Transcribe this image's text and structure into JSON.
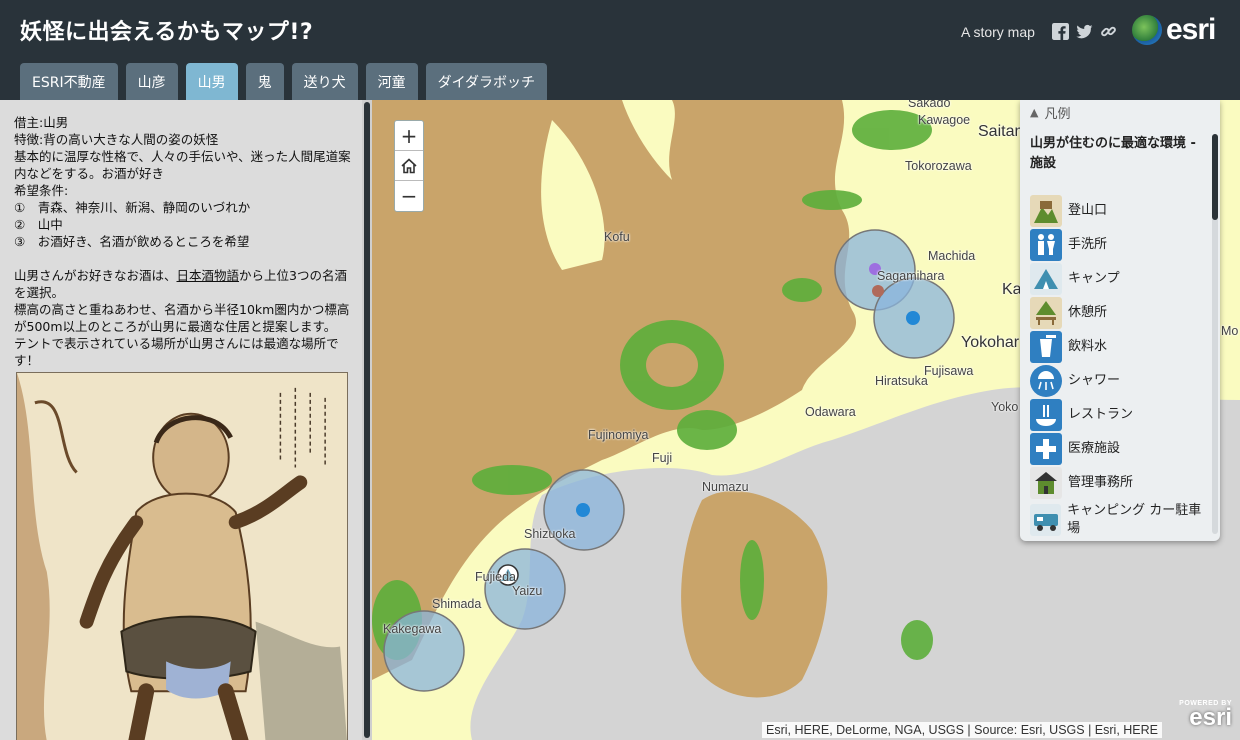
{
  "app": {
    "title": "妖怪に出会えるかもマップ!?",
    "story_link": "A story map",
    "share_icons": [
      "facebook-icon",
      "twitter-icon",
      "link-icon"
    ],
    "logo_text": "esri"
  },
  "tabs": [
    {
      "label": "ESRI不動産",
      "active": false
    },
    {
      "label": "山彦",
      "active": false
    },
    {
      "label": "山男",
      "active": true
    },
    {
      "label": "鬼",
      "active": false
    },
    {
      "label": "送り犬",
      "active": false
    },
    {
      "label": "河童",
      "active": false
    },
    {
      "label": "ダイダラボッチ",
      "active": false
    }
  ],
  "panel": {
    "lines": [
      "借主:山男",
      "特徴:背の高い大きな人間の姿の妖怪",
      "基本的に温厚な性格で、人々の手伝いや、迷った人間尾道案内などをする。お酒が好き",
      "希望条件:",
      "①　青森、神奈川、新潟、静岡のいづれか",
      "②　山中",
      "③　お酒好き、名酒が飲めるところを希望"
    ],
    "para2_before": "山男さんがお好きなお酒は、",
    "para2_link": "日本酒物語",
    "para2_after": "から上位3つの名酒を選択。",
    "para3": "標高の高さと重ねあわせ、名酒から半径10km圏内かつ標高が500m以上のところが山男に最適な住居と提案します。",
    "para4": "テントで表示されている場所が山男さんには最適な場所です！"
  },
  "map": {
    "places": [
      {
        "name": "Sakado",
        "big": false
      },
      {
        "name": "Kawagoe",
        "big": false
      },
      {
        "name": "Saitam",
        "big": true
      },
      {
        "name": "Tokorozawa",
        "big": false
      },
      {
        "name": "Kofu",
        "big": false
      },
      {
        "name": "Machida",
        "big": false
      },
      {
        "name": "Sagamihara",
        "big": false
      },
      {
        "name": "Ka",
        "big": true
      },
      {
        "name": "Mo",
        "big": false
      },
      {
        "name": "Yokohar",
        "big": true
      },
      {
        "name": "Fujisawa",
        "big": false
      },
      {
        "name": "Hiratsuka",
        "big": false
      },
      {
        "name": "Yoko",
        "big": false
      },
      {
        "name": "Odawara",
        "big": false
      },
      {
        "name": "Fujinomiya",
        "big": false
      },
      {
        "name": "Fuji",
        "big": false
      },
      {
        "name": "Numazu",
        "big": false
      },
      {
        "name": "Shizuoka",
        "big": false
      },
      {
        "name": "Fujieda",
        "big": false
      },
      {
        "name": "Yaizu",
        "big": false
      },
      {
        "name": "Shimada",
        "big": false
      },
      {
        "name": "Kakegawa",
        "big": false
      }
    ],
    "zoom_in": "+",
    "zoom_out": "−",
    "attribution": "Esri, HERE, DeLorme, NGA, USGS | Source: Esri, USGS | Esri, HERE",
    "powered_small": "POWERED BY",
    "powered_big": "esri"
  },
  "legend": {
    "header": "凡例",
    "subtitle": "山男が住むのに最適な環境 - 施設",
    "items": [
      {
        "label": "登山口",
        "icon": "trailhead-icon",
        "color": "#5e8c2e"
      },
      {
        "label": "手洗所",
        "icon": "restroom-icon",
        "color": "#2f7fc1"
      },
      {
        "label": "キャンプ",
        "icon": "tent-icon",
        "color": "#3f8fb0"
      },
      {
        "label": "休憩所",
        "icon": "rest-area-icon",
        "color": "#5e8c2e"
      },
      {
        "label": "飲料水",
        "icon": "drinking-water-icon",
        "color": "#2f7fc1"
      },
      {
        "label": "シャワー",
        "icon": "shower-icon",
        "color": "#2f7fc1"
      },
      {
        "label": "レストラン",
        "icon": "restaurant-icon",
        "color": "#2f7fc1"
      },
      {
        "label": "医療施設",
        "icon": "medical-icon",
        "color": "#2f7fc1"
      },
      {
        "label": "管理事務所",
        "icon": "ranger-station-icon",
        "color": "#5e8c2e"
      },
      {
        "label": "キャンピング カー駐車場",
        "icon": "rv-parking-icon",
        "color": "#3f8fb0"
      }
    ]
  },
  "colors": {
    "header_bg": "#29333a",
    "tab": "#5b6f7d",
    "tab_active": "#7fb7d2",
    "terrain_high": "#c9a46a",
    "vegetation": "#5cae3b",
    "lowland": "#fafbc0",
    "sea": "#d4d4d4",
    "buffer_circle": "#8ab4dc"
  }
}
